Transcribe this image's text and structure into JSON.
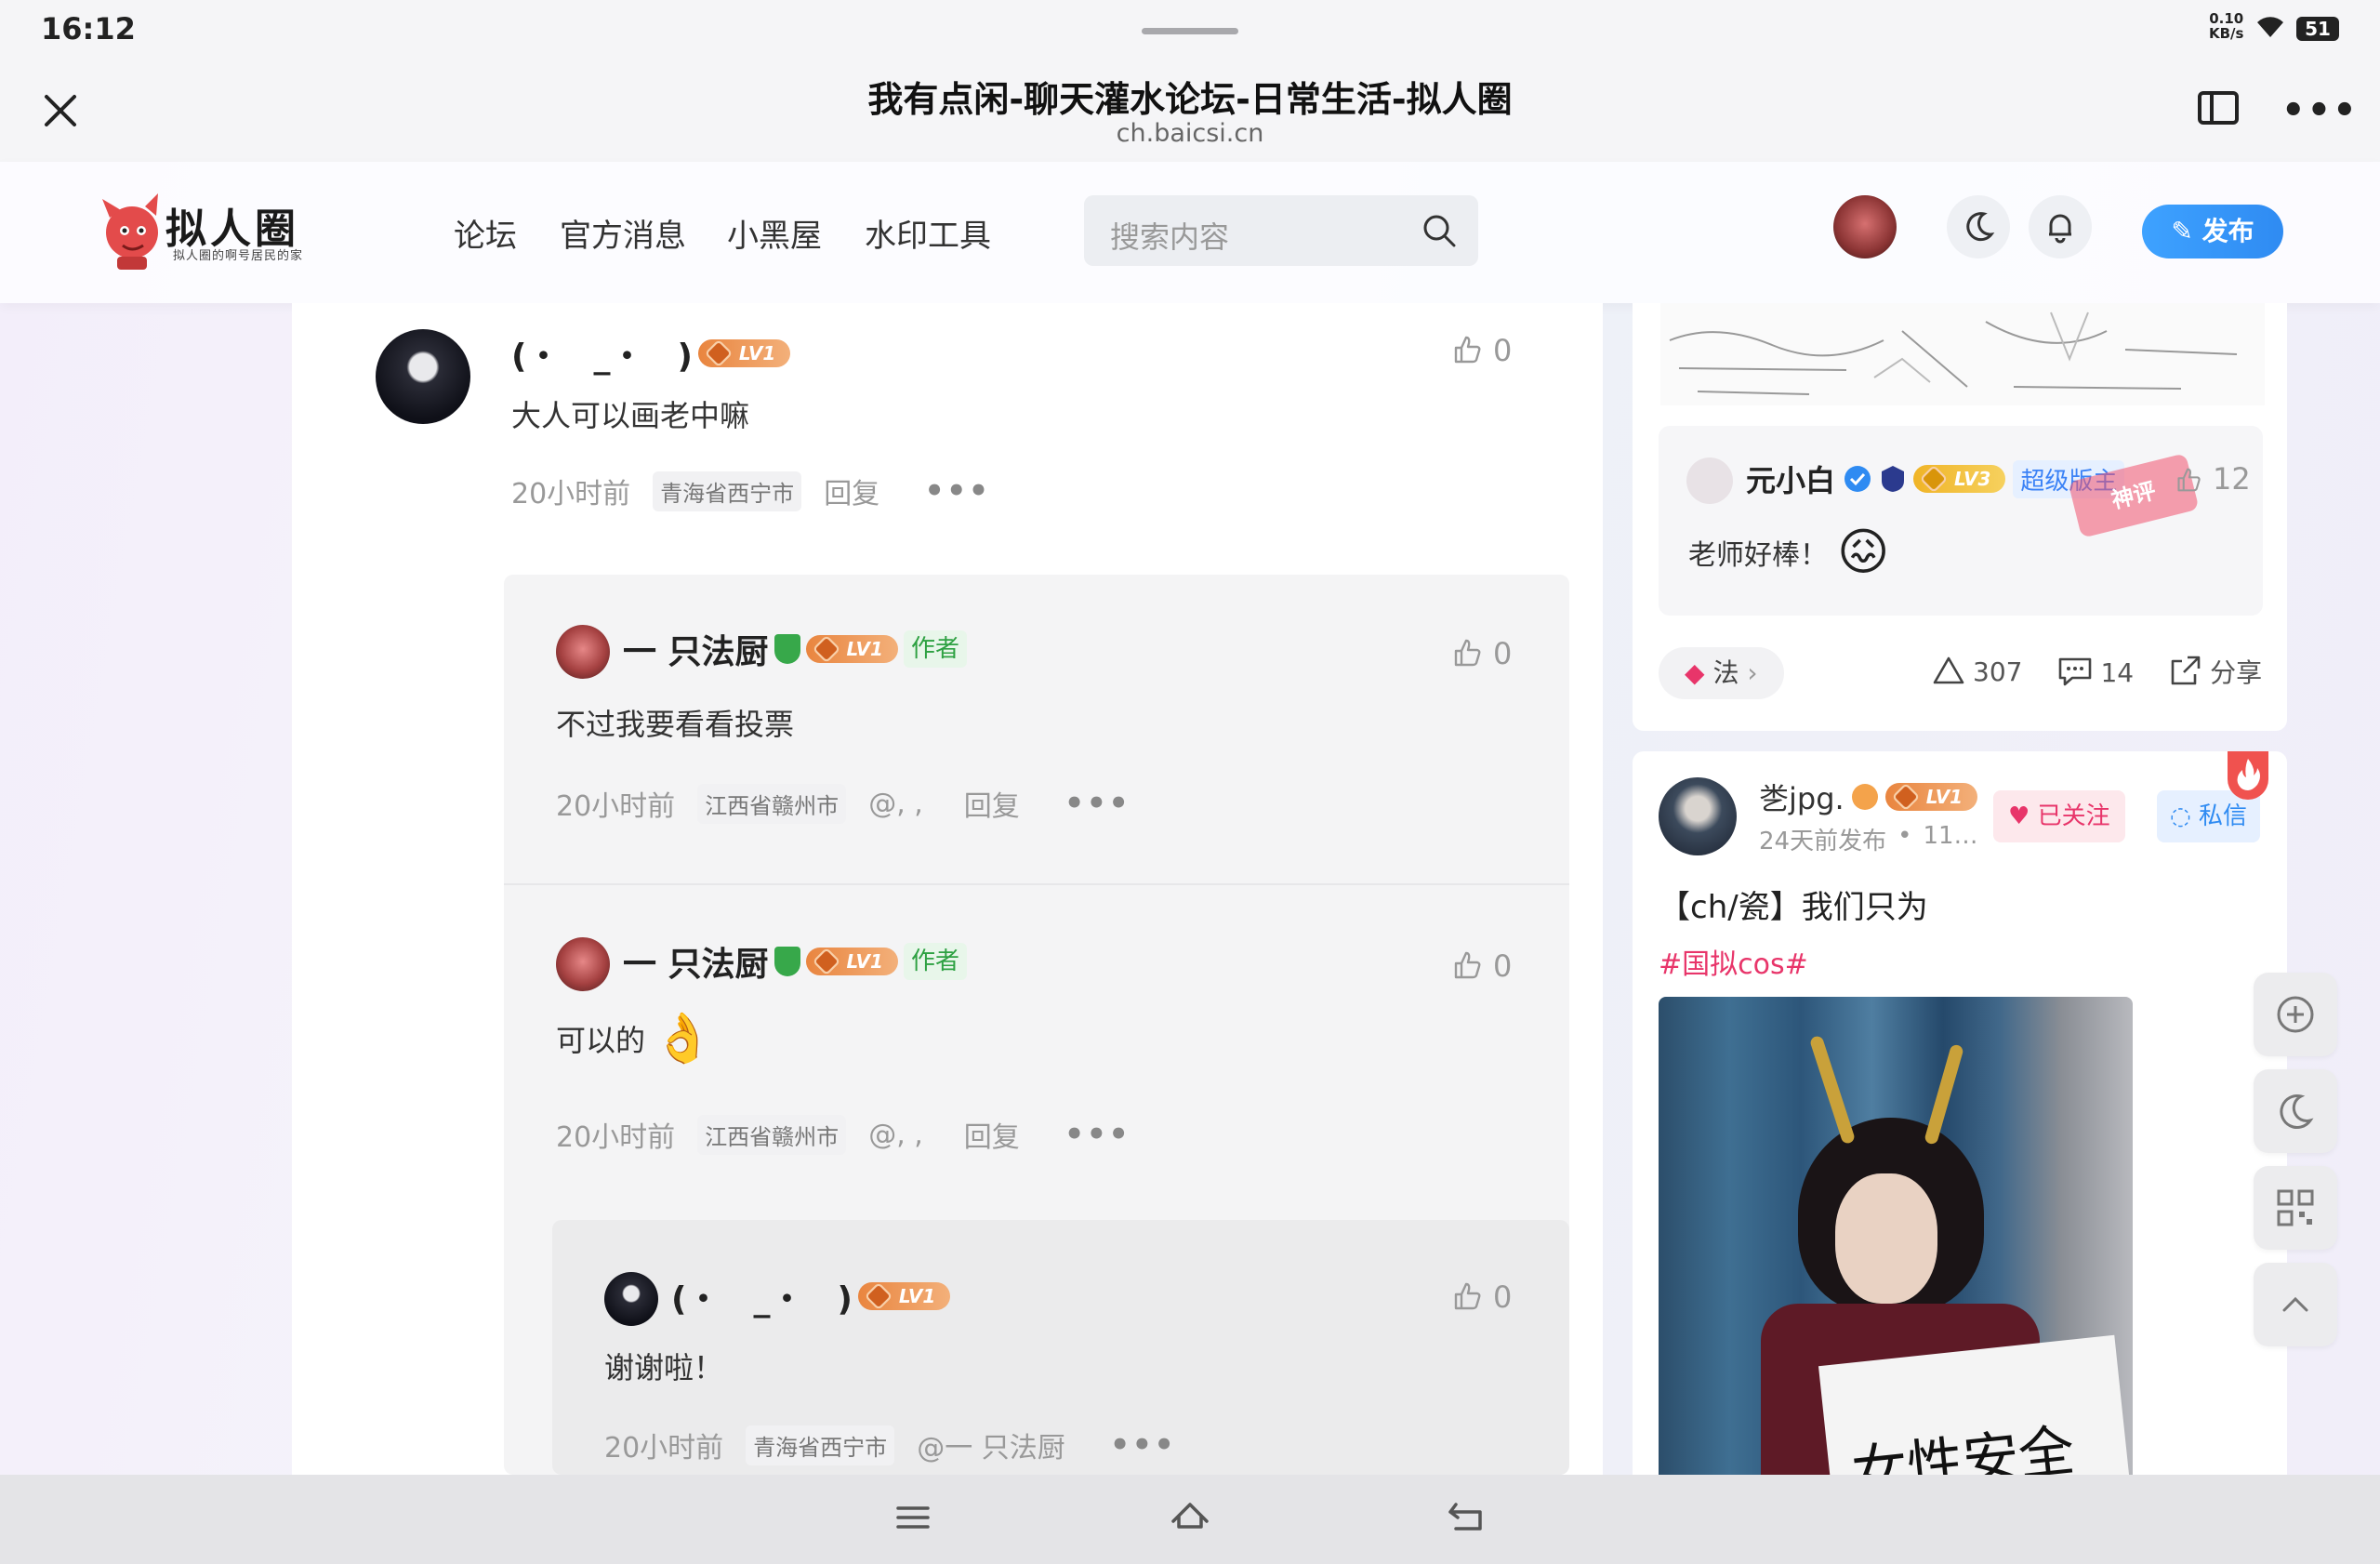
{
  "status_bar": {
    "time": "16:12",
    "speed_value": "0.10",
    "speed_unit": "KB/s",
    "battery": "51"
  },
  "browser": {
    "title": "我有点闲-聊天灌水论坛-日常生活-拟人圈",
    "url": "ch.baicsi.cn"
  },
  "site": {
    "logo_text": "拟人圈",
    "logo_sub": "拟人圈的啊号居民的家",
    "nav": [
      "论坛",
      "官方消息",
      "小黑屋",
      "水印工具"
    ],
    "search_placeholder": "搜索内容",
    "publish_label": "发布"
  },
  "comments": {
    "main": {
      "user": "(・　_・　)",
      "level": "LV1",
      "text": "大人可以画老中嘛",
      "time": "20小时前",
      "location": "青海省西宁市",
      "reply_label": "回复",
      "likes": "0"
    },
    "replies": [
      {
        "user": "一 只法厨",
        "level": "LV1",
        "author_tag": "作者",
        "text": "不过我要看看投票",
        "time": "20小时前",
        "location": "江西省赣州市",
        "mention": "@, ,",
        "reply_label": "回复",
        "likes": "0"
      },
      {
        "user": "一 只法厨",
        "level": "LV1",
        "author_tag": "作者",
        "text": "可以的",
        "emoji": "👌",
        "time": "20小时前",
        "location": "江西省赣州市",
        "mention": "@, ,",
        "reply_label": "回复",
        "likes": "0"
      }
    ],
    "nested": {
      "user": "(・　_・　)",
      "level": "LV1",
      "text": "谢谢啦！",
      "time": "20小时前",
      "location": "青海省西宁市",
      "mention": "@一 只法厨",
      "likes": "0"
    }
  },
  "sidebar": {
    "hot_comment": {
      "user": "元小白",
      "level": "LV3",
      "role": "超级版主",
      "stamp": "神评",
      "likes": "12",
      "text": "老师好棒！",
      "emoji": "😖"
    },
    "post_stats": {
      "tag": "法",
      "upvotes": "307",
      "comments": "14",
      "share_label": "分享"
    },
    "post2": {
      "user": "㐘jpg.",
      "level": "LV1",
      "time": "24天前发布",
      "extra": "11…",
      "followed_label": "已关注",
      "message_label": "私信",
      "title": "【ch/瓷】我们只为",
      "hashtag": "#国拟cos#",
      "image_text": "女性安全"
    }
  },
  "colors": {
    "accent": "#3b9bff",
    "author_green": "#2ea142",
    "hot_red": "#f0524f",
    "hashtag": "#e8356a"
  }
}
